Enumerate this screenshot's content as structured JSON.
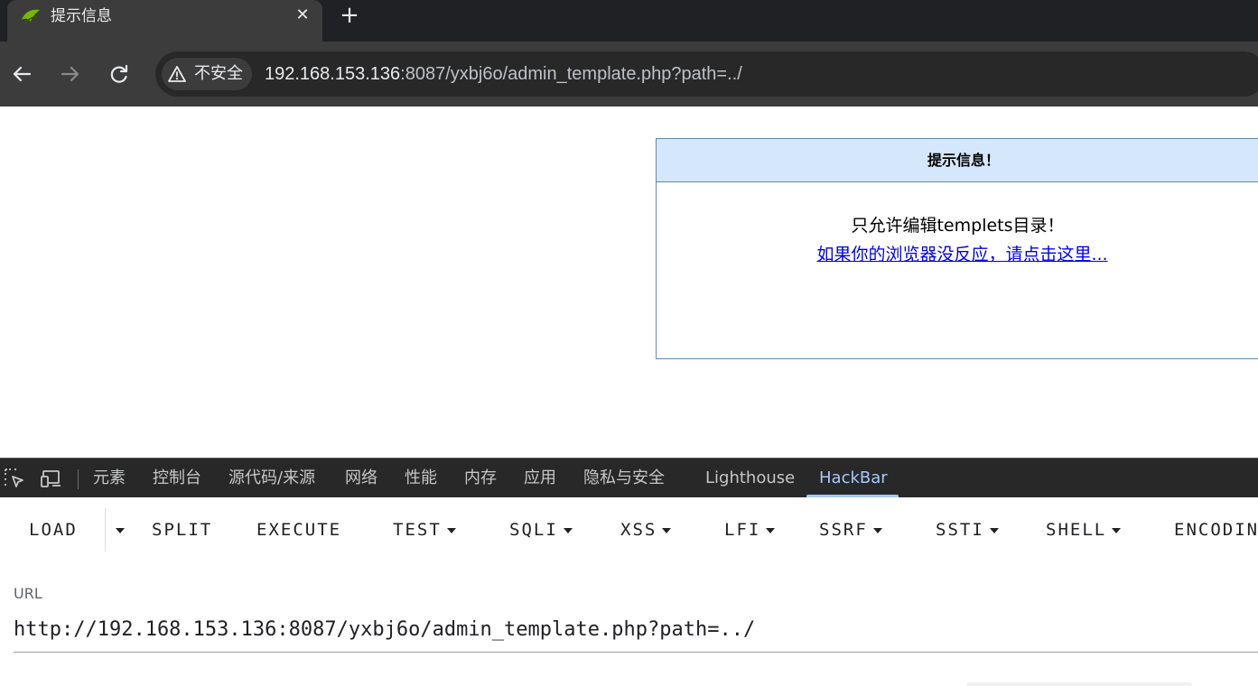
{
  "browser": {
    "tab": {
      "title": "提示信息",
      "close_glyph": "✕",
      "favicon": "leaf-icon"
    },
    "new_tab_glyph": "+",
    "security_label": "不安全",
    "url": {
      "host": "192.168.153.136",
      "rest": ":8087/yxbj6o/admin_template.php?path=../"
    }
  },
  "page": {
    "box_title": "提示信息！",
    "message": "只允许编辑templets目录！",
    "link": "如果你的浏览器没反应，请点击这里..."
  },
  "devtools": {
    "tabs": [
      "元素",
      "控制台",
      "源代码/来源",
      "网络",
      "性能",
      "内存",
      "应用",
      "隐私与安全",
      "Lighthouse",
      "HackBar"
    ],
    "active_tab": "HackBar"
  },
  "hackbar": {
    "buttons": {
      "load": "LOAD",
      "split": "SPLIT",
      "execute": "EXECUTE",
      "test": "TEST",
      "sqli": "SQLI",
      "xss": "XSS",
      "lfi": "LFI",
      "ssrf": "SSRF",
      "ssti": "SSTI",
      "shell": "SHELL",
      "encoding": "ENCODING"
    },
    "url_label": "URL",
    "url_value": "http://192.168.153.136:8087/yxbj6o/admin_template.php?path=../"
  },
  "colors": {
    "tab_bg": "#3c3c3c",
    "header_bg": "#d5e7fa",
    "link": "#0000ee",
    "active_tab": "#a8c7fa"
  }
}
